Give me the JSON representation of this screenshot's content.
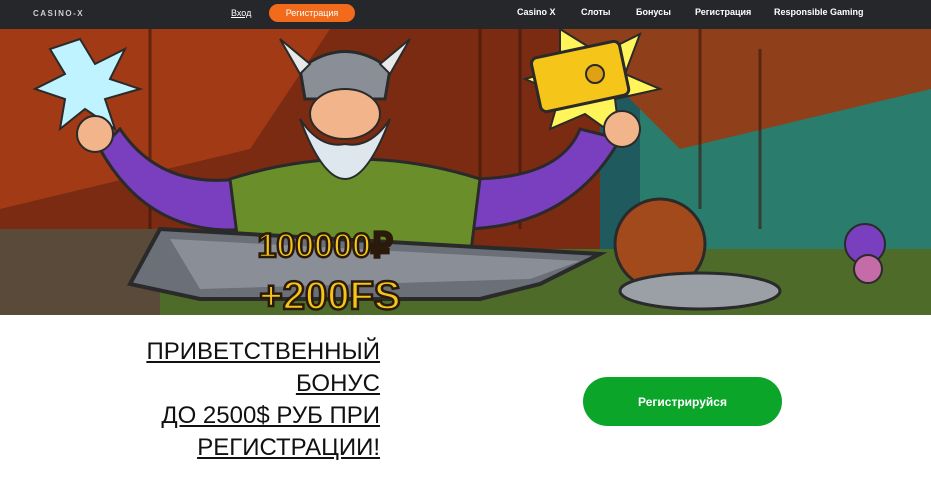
{
  "header": {
    "logo": "CASINO-X",
    "login": "Вход",
    "register": "Регистрация",
    "nav": [
      "Casino X",
      "Слоты",
      "Бонусы",
      "Регистрация",
      "Responsible Gaming"
    ]
  },
  "banner": {
    "amount": "100000₽",
    "freespins": "+200FS"
  },
  "promo": {
    "lines": [
      "ПРИВЕТСТВЕННЫЙ",
      "БОНУС",
      "ДО 2500$ РУБ ПРИ",
      "РЕГИСТРАЦИИ!"
    ]
  },
  "cta": {
    "label": "Регистрируйся"
  },
  "colors": {
    "header_bg": "#26272b",
    "accent_orange": "#f26a1b",
    "cta_green": "#0aa529"
  }
}
